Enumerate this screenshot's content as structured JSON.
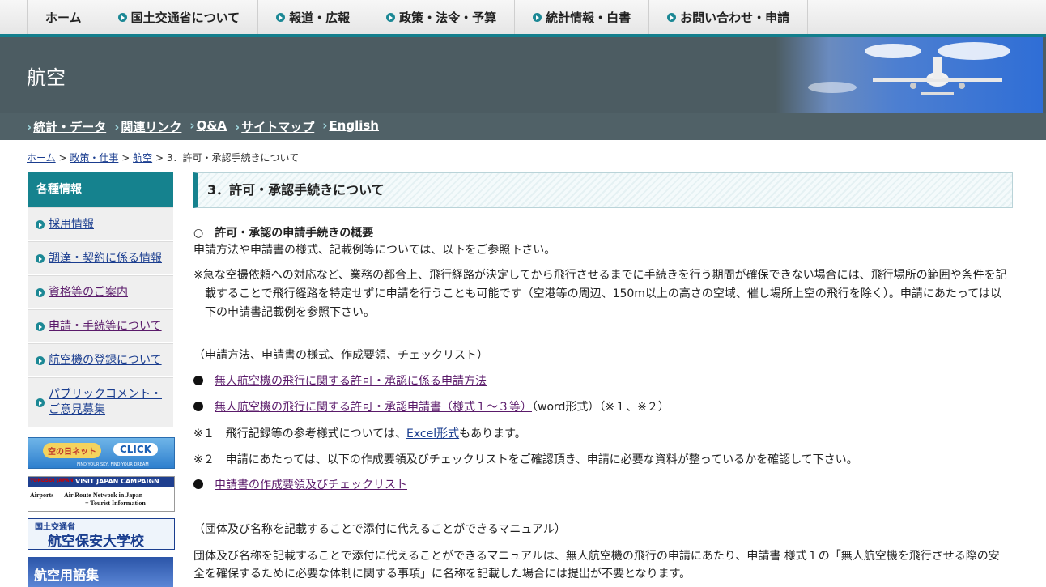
{
  "topnav": {
    "home": "ホーム",
    "items": [
      "国土交通省について",
      "報道・広報",
      "政策・法令・予算",
      "統計情報・白書",
      "お問い合わせ・申請"
    ]
  },
  "header": {
    "title": "航空"
  },
  "subnav": {
    "links": [
      "統計・データ",
      "関連リンク",
      "Q&A",
      "サイトマップ",
      "English"
    ]
  },
  "breadcrumb": {
    "links": [
      "ホーム",
      "政策・仕事",
      "航空"
    ],
    "sep": ">",
    "current": "3．許可・承認手続きについて"
  },
  "sidebar": {
    "heading": "各種情報",
    "items": [
      "採用情報",
      "調達・契約に係る情報",
      "資格等のご案内",
      "申請・手続等について",
      "航空機の登録について",
      "パブリックコメント・ご意見募集"
    ],
    "banners": {
      "sora": {
        "text1": "空の日ネット",
        "text2": "CLICK",
        "text3": "FIND YOUR SKY, FIND YOUR DREAM"
      },
      "visit": {
        "line1": "VISIT JAPAN CAMPAIGN",
        "line2": "Airports",
        "line3": "Air Route Network in Japan",
        "line4": "+ Tourist Information",
        "logo": "YOKOSO! JAPAN"
      },
      "school": {
        "line1": "国土交通省",
        "line2": "航空保安大学校"
      },
      "glossary": {
        "text": "航空用語集"
      }
    }
  },
  "main": {
    "heading": "3．許可・承認手続きについて",
    "overview_title": "○　許可・承認の申請手続きの概要",
    "overview_text": "申請方法や申請書の様式、記載例等については、以下をご参照下さい。",
    "note_line1": "※急な空撮依頼への対応など、業務の都合上、飛行経路が決定してから飛行させるまでに手続きを行う期間が確保できない場合には、飛行場所の範囲や条件を記",
    "note_line2": "載することで飛行経路を特定せずに申請を行うことも可能です（空港等の周辺、150m以上の高さの空域、催し場所上空の飛行を除く）。申請にあたっては以",
    "note_line3": "下の申請書記載例を参照下さい。",
    "section1": "（申請方法、申請書の様式、作成要領、チェックリスト）",
    "link1": "無人航空機の飛行に関する許可・承認に係る申請方法",
    "link2": "無人航空機の飛行に関する許可・承認申請書（様式１～３等）",
    "link2_suffix": "（word形式）（※１、※２）",
    "note1_prefix": "※１　飛行記録等の参考様式については、",
    "note1_link": "Excel形式",
    "note1_suffix": "もあります。",
    "note2": "※２　申請にあたっては、以下の作成要領及びチェックリストをご確認頂き、申請に必要な資料が整っているかを確認して下さい。",
    "link3": "申請書の作成要領及びチェックリスト",
    "section2": "（団体及び名称を記載することで添付に代えることができるマニュアル）",
    "manual_line1": "団体及び名称を記載することで添付に代えることができるマニュアルは、無人航空機の飛行の申請にあたり、申請書 様式１の「無人航空機を飛行させる際の安",
    "manual_line2": "全を確保するために必要な体制に関する事項」に名称を記載した場合には提出が不要となります。"
  }
}
